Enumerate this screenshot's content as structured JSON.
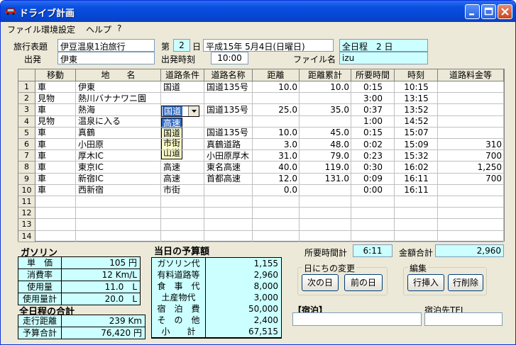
{
  "window": {
    "title": "ドライブ計画"
  },
  "menu": [
    "ファイル",
    "環境設定",
    "ヘルプ",
    "?"
  ],
  "header": {
    "trip_title_label": "旅行表題",
    "trip_title": "伊豆温泉1泊旅行",
    "day_prefix": "第",
    "day_number": "2",
    "day_suffix": "日",
    "date": "平成15年 5月4日(日曜日)",
    "total_days": "全日程　2 日",
    "depart_label": "出発",
    "depart_place": "伊東",
    "depart_time_label": "出発時刻",
    "depart_time": "10:00",
    "filename_label": "ファイル名",
    "filename": "izu"
  },
  "table": {
    "headers": [
      "移動",
      "地　　名",
      "道路条件",
      "道路名称",
      "距離",
      "距離累計",
      "所要時間",
      "時刻",
      "道路料金等"
    ],
    "rows": [
      [
        "車",
        "伊東",
        "国道",
        "国道135号",
        "10.0",
        "10.0",
        "0:15",
        "10:15",
        ""
      ],
      [
        "見物",
        "熱川バナナワニ園",
        "",
        "",
        "",
        "",
        "3:00",
        "13:15",
        ""
      ],
      [
        "車",
        "熱海",
        "国道",
        "国道135号",
        "25.0",
        "35.0",
        "0:37",
        "13:52",
        ""
      ],
      [
        "見物",
        "温泉に入る",
        "",
        "",
        "",
        "",
        "1:00",
        "14:52",
        ""
      ],
      [
        "車",
        "真鶴",
        "",
        "国道135号",
        "10.0",
        "45.0",
        "0:15",
        "15:07",
        ""
      ],
      [
        "車",
        "小田原",
        "",
        "真鶴道路",
        "3.0",
        "48.0",
        "0:02",
        "15:09",
        "310"
      ],
      [
        "車",
        "厚木IC",
        "",
        "小田原厚木",
        "31.0",
        "79.0",
        "0:23",
        "15:32",
        "700"
      ],
      [
        "車",
        "東京IC",
        "高速",
        "東名高速",
        "40.0",
        "119.0",
        "0:30",
        "16:02",
        "1,250"
      ],
      [
        "車",
        "新宿IC",
        "高速",
        "首都高速",
        "12.0",
        "131.0",
        "0:09",
        "16:11",
        "700"
      ],
      [
        "車",
        "西新宿",
        "市街",
        "",
        "0.0",
        "",
        "0:00",
        "16:11",
        ""
      ],
      [
        "",
        "",
        "",
        "",
        "",
        "",
        "",
        "",
        ""
      ],
      [
        "",
        "",
        "",
        "",
        "",
        "",
        "",
        "",
        ""
      ],
      [
        "",
        "",
        "",
        "",
        "",
        "",
        "",
        "",
        ""
      ],
      [
        "",
        "",
        "",
        "",
        "",
        "",
        "",
        "",
        ""
      ]
    ],
    "row_numbers": [
      "1",
      "2",
      "3",
      "4",
      "5",
      "6",
      "7",
      "8",
      "9",
      "10",
      "11",
      "12",
      "13",
      "14"
    ],
    "dropdown_value": "国道",
    "dropdown_options": [
      "高速",
      "国道",
      "市街",
      "山道"
    ]
  },
  "gasoline": {
    "title": "ガソリン",
    "rows": [
      {
        "label": "単　価",
        "value": "105 円"
      },
      {
        "label": "消費率",
        "value": "12 Km/L"
      },
      {
        "label": "使用量",
        "value": "11.0　L"
      },
      {
        "label": "使用量計",
        "value": "20.0　L"
      }
    ]
  },
  "totals": {
    "title": "全日程の合計",
    "rows": [
      {
        "label": "走行距離",
        "value": "239 Km"
      },
      {
        "label": "予算合計",
        "value": "76,420 円"
      }
    ]
  },
  "budget": {
    "title": "当日の予算額",
    "rows": [
      {
        "label": "ガソリン代",
        "value": "1,155"
      },
      {
        "label": "有料道路等",
        "value": "2,960"
      },
      {
        "label": "食　事　代",
        "value": "8,000"
      },
      {
        "label": "土産物代",
        "value": "3,000"
      },
      {
        "label": "宿　泊　費",
        "value": "50,000"
      },
      {
        "label": "そ　の　他",
        "value": "2,400"
      },
      {
        "label": "小　　計",
        "value": "67,515"
      }
    ]
  },
  "summary": {
    "time_label": "所要時間計",
    "time_value": "6:11",
    "amount_label": "金額合計",
    "amount_value": "2,960"
  },
  "day_change": {
    "title": "日にちの変更",
    "next": "次の日",
    "prev": "前の日"
  },
  "edit": {
    "title": "編集",
    "insert": "行挿入",
    "delete": "行削除"
  },
  "lodging": {
    "title": "【宿泊】",
    "value": "",
    "tel_label": "宿泊先TEL",
    "tel_value": ""
  }
}
